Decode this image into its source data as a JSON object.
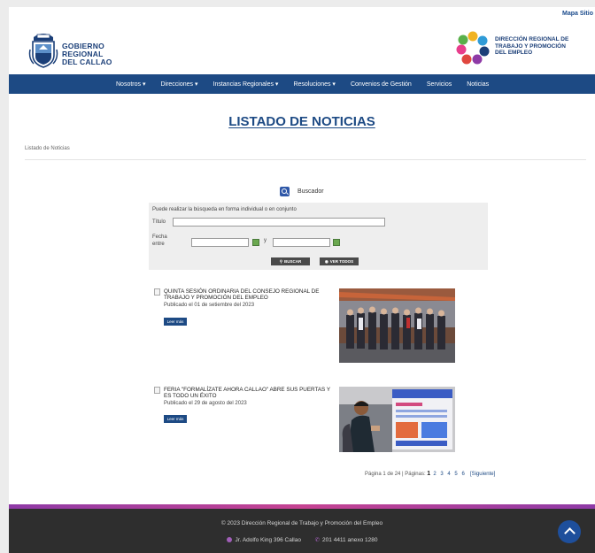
{
  "header": {
    "site_map_label": "Mapa Sitio",
    "org_logo_lines": [
      "GOBIERNO",
      "REGIONAL",
      "DEL CALLAO"
    ],
    "dept_logo_lines": [
      "DIRECCIÓN REGIONAL DE",
      "TRABAJO Y PROMOCIÓN",
      "DEL EMPLEO"
    ]
  },
  "nav": {
    "items": [
      "Nosotros ▾",
      "Direcciones ▾",
      "Instancias Regionales ▾",
      "Resoluciones ▾",
      "Convenios de Gestión",
      "Servicios",
      "Noticias"
    ]
  },
  "page": {
    "title": "LISTADO DE NOTICIAS",
    "breadcrumb": "Listado de Noticias"
  },
  "search": {
    "heading": "Buscador",
    "hint": "Puede realizar la búsqueda en forma individual o en conjunto",
    "title_label": "Título",
    "title_value": "",
    "date_label_1": "Fecha",
    "date_label_2": "entre",
    "date_from": "",
    "date_to": "",
    "date_joiner": "y",
    "search_button": "BUSCAR",
    "view_all_button": "VER TODOS"
  },
  "news": [
    {
      "headline": "QUINTA SESIÓN ORDINARIA DEL CONSEJO REGIONAL DE TRABAJO Y PROMOCIÓN DEL EMPLEO",
      "date": "Publicado el 01 de setiembre del 2023",
      "more_label": "Leer más"
    },
    {
      "headline": "FERIA \"FORMALÍZATE AHORA CALLAO\" ABRE SUS PUERTAS Y ES TODO UN ÉXITO",
      "date": "Publicado el 29 de agosto del 2023",
      "more_label": "Leer más"
    }
  ],
  "pager": {
    "summary": "Página 1 de 24 | Páginas:",
    "current": "1",
    "pages": [
      "2",
      "3",
      "4",
      "5",
      "6"
    ],
    "next": "[Siguiente]"
  },
  "footer": {
    "copyright": "© 2023 Dirección Regional de Trabajo y Promoción del Empleo",
    "address": "Jr. Adolfo King 396 Callao",
    "phone": "201 4411 anexo 1280"
  },
  "colors": {
    "brand_blue": "#1d4a84",
    "footer_bg": "#2e2e2e",
    "footer_accent": "#c64392"
  }
}
